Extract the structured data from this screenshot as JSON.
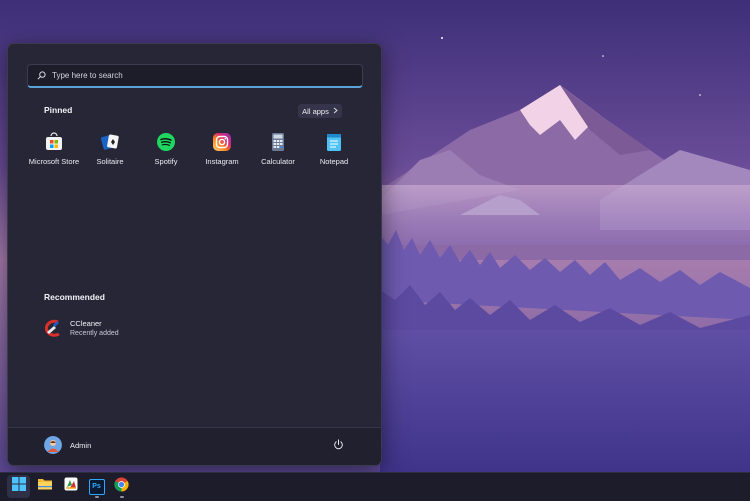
{
  "search": {
    "placeholder": "Type here to search"
  },
  "pinned": {
    "title": "Pinned",
    "all_apps_label": "All apps",
    "apps": [
      {
        "label": "Microsoft Store",
        "icon": "microsoft-store-icon"
      },
      {
        "label": "Solitaire",
        "icon": "solitaire-icon"
      },
      {
        "label": "Spotify",
        "icon": "spotify-icon"
      },
      {
        "label": "Instagram",
        "icon": "instagram-icon"
      },
      {
        "label": "Calculator",
        "icon": "calculator-icon"
      },
      {
        "label": "Notepad",
        "icon": "notepad-icon"
      }
    ]
  },
  "recommended": {
    "title": "Recommended",
    "items": [
      {
        "name": "CCleaner",
        "subtitle": "Recently added",
        "icon": "ccleaner-icon"
      }
    ]
  },
  "user": {
    "name": "Admin"
  },
  "taskbar": {
    "items": [
      {
        "name": "start",
        "icon": "windows-icon",
        "active": true
      },
      {
        "name": "file-explorer",
        "icon": "folder-icon",
        "active": false
      },
      {
        "name": "app",
        "icon": "app-icon",
        "active": false
      },
      {
        "name": "photoshop",
        "icon": "photoshop-icon",
        "label": "Ps",
        "active": false
      },
      {
        "name": "chrome",
        "icon": "chrome-icon",
        "active": false
      }
    ]
  },
  "colors": {
    "menu_bg": "#262636",
    "accent": "#5ba3d6",
    "taskbar_bg": "#1c1c2b"
  }
}
